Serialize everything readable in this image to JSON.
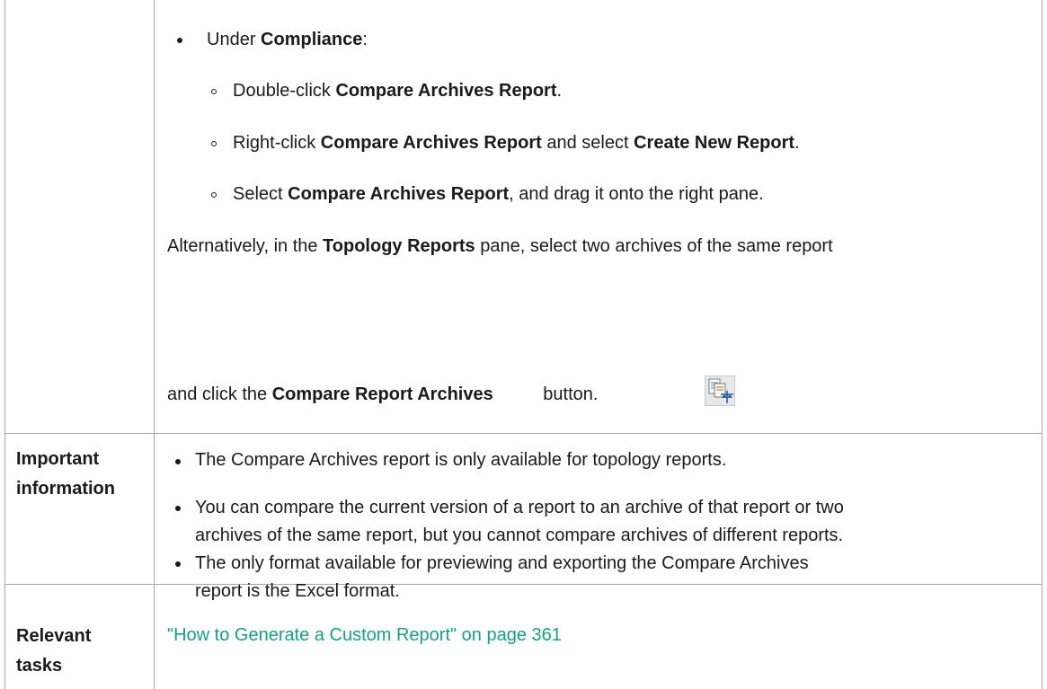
{
  "row_setup": {
    "compliance_bullet": {
      "prefix": "Under ",
      "bold": "Compliance",
      "suffix": ":"
    },
    "sub_bullets": [
      {
        "prefix": "Double-click ",
        "bold1": "Compare Archives Report",
        "middle": ".",
        "bold2": "",
        "suffix": ""
      },
      {
        "prefix": "Right-click ",
        "bold1": "Compare Archives Report",
        "middle": " and select ",
        "bold2": "Create New Report",
        "suffix": "."
      },
      {
        "prefix": "Select ",
        "bold1": "Compare Archives Report",
        "middle": ", and drag it onto the right pane.",
        "bold2": "",
        "suffix": ""
      }
    ],
    "alt_line1": {
      "prefix": "Alternatively, in the ",
      "bold": "Topology Reports",
      "suffix": " pane, select two archives of the same report"
    },
    "alt_line2": {
      "prefix": "and click the ",
      "bold": "Compare Report Archives",
      "suffix": " button."
    },
    "button_icon": "compare-archives-icon"
  },
  "row_important": {
    "label_line1": "Important",
    "label_line2": "information",
    "bullets": [
      {
        "lines": [
          "The Compare Archives report is only available for topology reports."
        ]
      },
      {
        "lines": [
          "You can compare the current version of a report to an archive of that report or two",
          "archives of the same report, but you cannot compare archives of different reports."
        ]
      },
      {
        "lines": [
          "The only format available for previewing and exporting the Compare Archives",
          "report is the Excel format."
        ]
      }
    ]
  },
  "row_tasks": {
    "label_line1": "Relevant",
    "label_line2": "tasks",
    "link_text": "\"How to Generate a Custom Report\" on page 361"
  },
  "colors": {
    "link": "#16a086",
    "border": "#a8a8a8",
    "text": "#1a1a1a"
  }
}
